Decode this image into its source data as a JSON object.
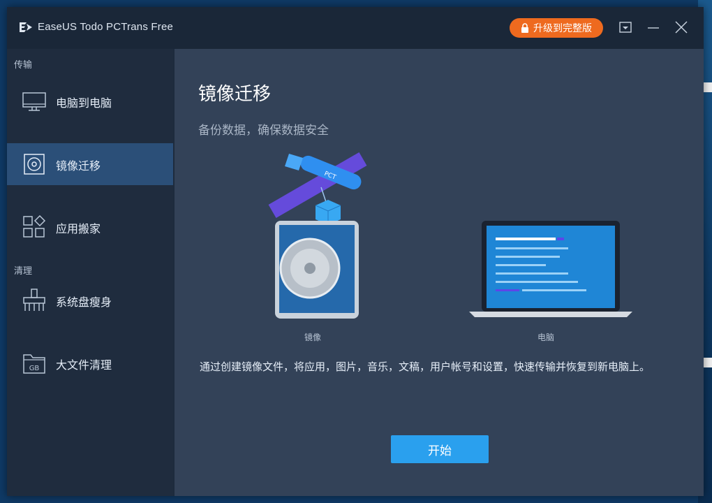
{
  "window": {
    "title": "EaseUS Todo PCTrans Free",
    "upgrade_label": "升级到完整版"
  },
  "sidebar": {
    "sections": [
      {
        "label": "传输",
        "items": [
          {
            "label": "电脑到电脑",
            "icon": "monitor-icon"
          },
          {
            "label": "镜像迁移",
            "icon": "disc-icon",
            "active": true
          },
          {
            "label": "应用搬家",
            "icon": "apps-icon"
          }
        ]
      },
      {
        "label": "清理",
        "items": [
          {
            "label": "系统盘瘦身",
            "icon": "broom-icon"
          },
          {
            "label": "大文件清理",
            "icon": "gb-folder-icon"
          }
        ]
      }
    ]
  },
  "main": {
    "title": "镜像迁移",
    "subtitle": "备份数据，确保数据安全",
    "illustration": {
      "tag_text": "PCT",
      "left_caption": "镜像",
      "right_caption": "电脑"
    },
    "description": "通过创建镜像文件，将应用，图片，音乐，文稿，用户帐号和设置，快速传输并恢复到新电脑上。",
    "start_label": "开始"
  },
  "colors": {
    "accent": "#2aa0ee",
    "upgrade": "#ee6a1f",
    "sidebar_active": "#2b4f78",
    "content_bg": "#334258"
  }
}
